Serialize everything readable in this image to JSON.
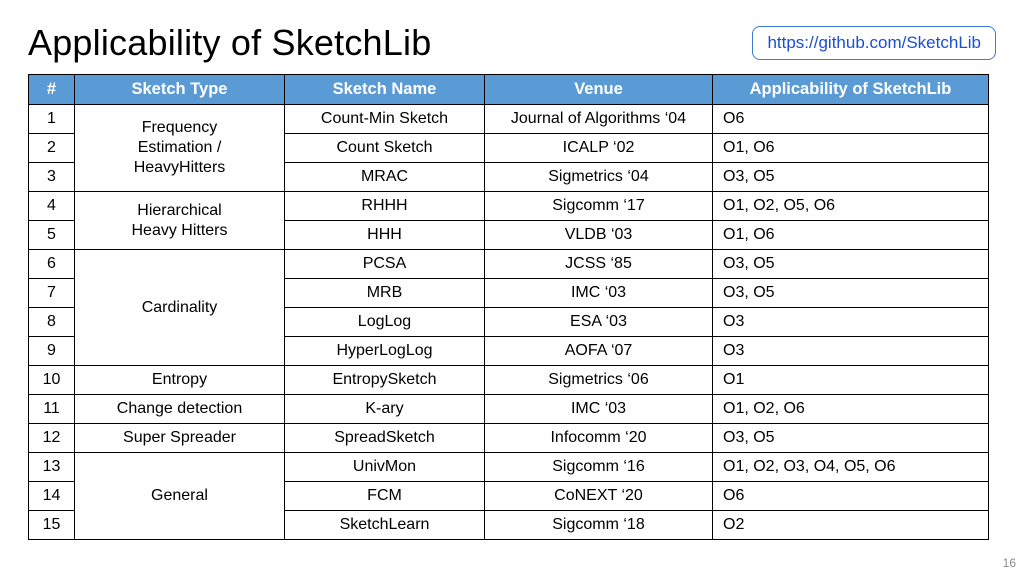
{
  "title": "Applicability of SketchLib",
  "github_url": "https://github.com/SketchLib",
  "page_number": "16",
  "columns": {
    "num": "#",
    "type": "Sketch Type",
    "name": "Sketch Name",
    "venue": "Venue",
    "app": "Applicability of SketchLib"
  },
  "groups": [
    {
      "type": "Frequency Estimation / HeavyHitters",
      "rows": [
        {
          "num": "1",
          "name": "Count-Min Sketch",
          "venue": "Journal of Algorithms ‘04",
          "app": "O6"
        },
        {
          "num": "2",
          "name": "Count Sketch",
          "venue": "ICALP ‘02",
          "app": "O1, O6"
        },
        {
          "num": "3",
          "name": "MRAC",
          "venue": "Sigmetrics ‘04",
          "app": "O3, O5"
        }
      ]
    },
    {
      "type": "Hierarchical Heavy Hitters",
      "rows": [
        {
          "num": "4",
          "name": "RHHH",
          "venue": "Sigcomm ‘17",
          "app": "O1, O2, O5, O6"
        },
        {
          "num": "5",
          "name": "HHH",
          "venue": "VLDB ‘03",
          "app": "O1, O6"
        }
      ]
    },
    {
      "type": "Cardinality",
      "rows": [
        {
          "num": "6",
          "name": "PCSA",
          "venue": "JCSS ‘85",
          "app": "O3, O5"
        },
        {
          "num": "7",
          "name": "MRB",
          "venue": "IMC ‘03",
          "app": "O3, O5"
        },
        {
          "num": "8",
          "name": "LogLog",
          "venue": "ESA ‘03",
          "app": "O3"
        },
        {
          "num": "9",
          "name": "HyperLogLog",
          "venue": "AOFA ‘07",
          "app": "O3"
        }
      ]
    },
    {
      "type": "Entropy",
      "rows": [
        {
          "num": "10",
          "name": "EntropySketch",
          "venue": "Sigmetrics ‘06",
          "app": "O1"
        }
      ]
    },
    {
      "type": "Change detection",
      "rows": [
        {
          "num": "11",
          "name": "K-ary",
          "venue": "IMC ‘03",
          "app": "O1, O2, O6"
        }
      ]
    },
    {
      "type": "Super Spreader",
      "rows": [
        {
          "num": "12",
          "name": "SpreadSketch",
          "venue": "Infocomm ‘20",
          "app": "O3, O5"
        }
      ]
    },
    {
      "type": "General",
      "rows": [
        {
          "num": "13",
          "name": "UnivMon",
          "venue": "Sigcomm ‘16",
          "app": "O1, O2, O3, O4, O5, O6"
        },
        {
          "num": "14",
          "name": "FCM",
          "venue": "CoNEXT ‘20",
          "app": "O6"
        },
        {
          "num": "15",
          "name": "SketchLearn",
          "venue": "Sigcomm ‘18",
          "app": "O2"
        }
      ]
    }
  ]
}
